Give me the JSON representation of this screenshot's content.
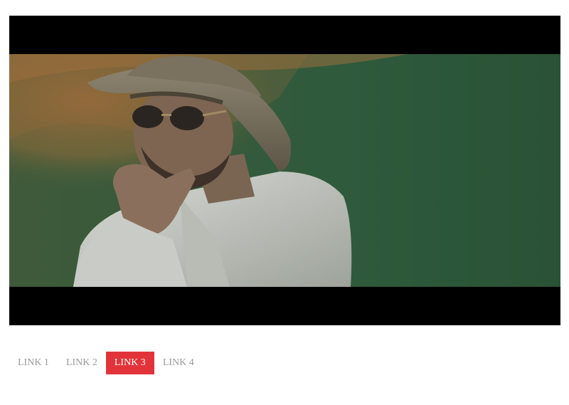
{
  "video": {
    "scene_description_icon": "video-frame-man-with-hat",
    "letterbox_color": "#000000"
  },
  "nav": {
    "links": [
      {
        "label": "LINK 1",
        "active": false
      },
      {
        "label": "LINK 2",
        "active": false
      },
      {
        "label": "LINK 3",
        "active": true
      },
      {
        "label": "LINK 4",
        "active": false
      }
    ]
  },
  "colors": {
    "active_bg": "#e2333a",
    "active_text": "#ffffff",
    "inactive_text": "#9a9a9a"
  }
}
